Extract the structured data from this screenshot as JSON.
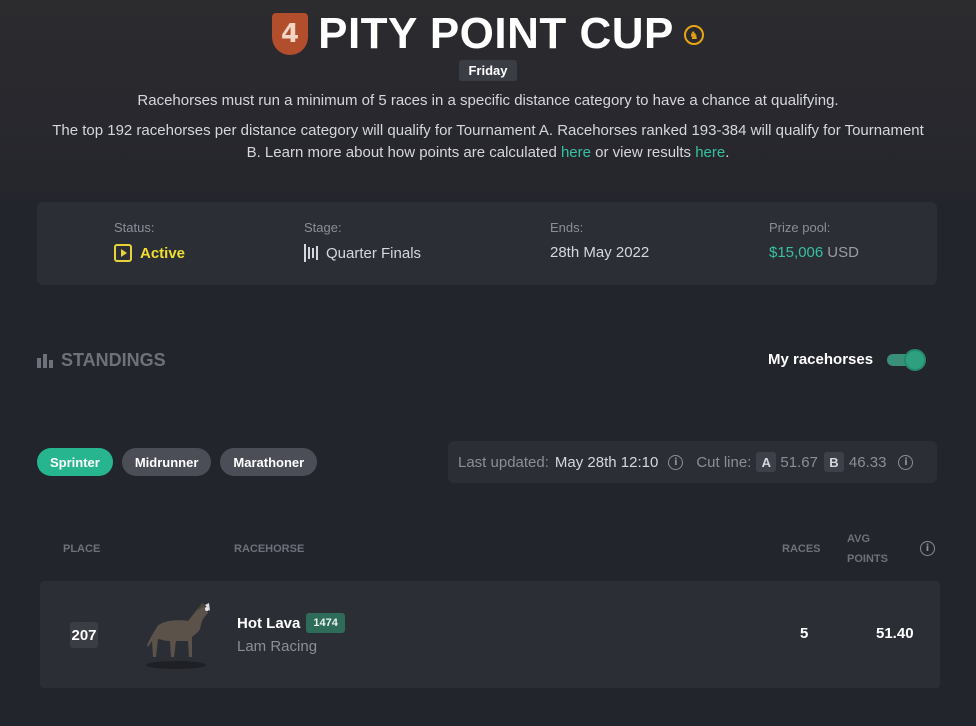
{
  "header": {
    "badge_number": "4",
    "title": "PITY POINT CUP",
    "day": "Friday",
    "desc_line1": "Racehorses must run a minimum of 5 races in a specific distance category to have a chance at qualifying.",
    "desc_line2_prefix": "The top 192 racehorses per distance category will qualify for Tournament A. Racehorses ranked 193-384 will qualify for Tournament B. Learn more about how points are calculated",
    "link_here_1": "here",
    "desc_line2_mid": "or view results",
    "link_here_2": "here",
    "desc_line2_suffix": "."
  },
  "info": {
    "status_label": "Status:",
    "status_value": "Active",
    "stage_label": "Stage:",
    "stage_value": "Quarter Finals",
    "ends_label": "Ends:",
    "ends_value": "28th May 2022",
    "prize_label": "Prize pool:",
    "prize_amount": "$15,006",
    "prize_currency": "USD"
  },
  "standings": {
    "heading": "STANDINGS",
    "toggle_label": "My racehorses",
    "toggle_on": true
  },
  "categories": [
    {
      "label": "Sprinter",
      "selected": true
    },
    {
      "label": "Midrunner",
      "selected": false
    },
    {
      "label": "Marathoner",
      "selected": false
    }
  ],
  "update": {
    "last_updated_label": "Last updated:",
    "last_updated_value": "May 28th 12:10",
    "cut_line_label": "Cut line:",
    "tier_a": "A",
    "cut_a": "51.67",
    "tier_b": "B",
    "cut_b": "46.33"
  },
  "table": {
    "headers": {
      "place": "PLACE",
      "racehorse": "RACEHORSE",
      "races": "RACES",
      "avg_line1": "AVG",
      "avg_line2": "POINTS"
    },
    "rows": [
      {
        "place": "207",
        "name": "Hot Lava",
        "rating": "1474",
        "stable": "Lam Racing",
        "races": "5",
        "avg_points": "51.40"
      }
    ]
  },
  "colors": {
    "accent_green": "#27b58f",
    "active_yellow": "#f2de2c",
    "badge_orange": "#b34e2c"
  },
  "icons": [
    "four-badge-icon",
    "horse-coin-icon",
    "play-square-icon",
    "stage-bars-icon",
    "bar-chart-icon",
    "info-icon"
  ]
}
